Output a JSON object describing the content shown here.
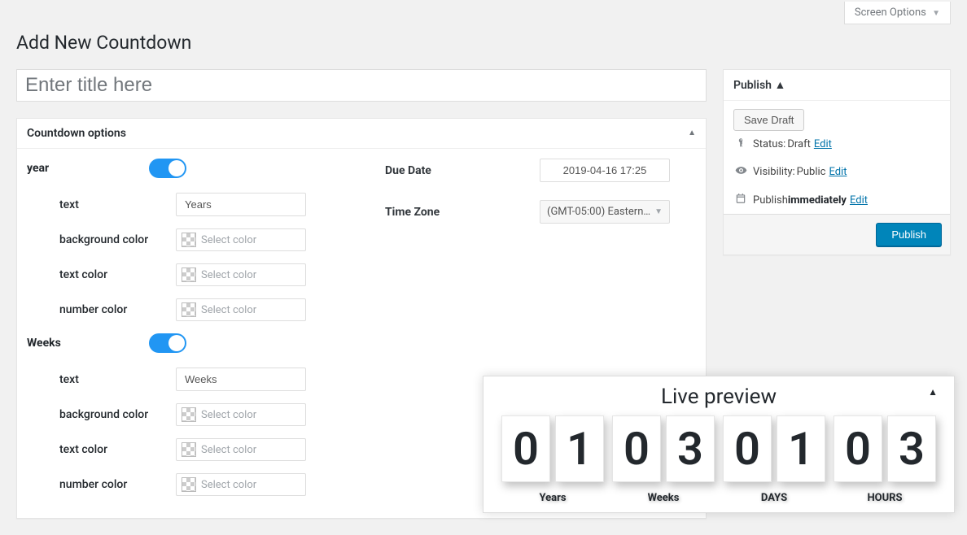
{
  "topbar": {
    "screen_options": "Screen Options"
  },
  "page": {
    "title": "Add New Countdown",
    "title_placeholder": "Enter title here"
  },
  "options": {
    "panel_title": "Countdown options",
    "color_placeholder": "Select color",
    "year": {
      "label": "year",
      "text_label": "text",
      "text_value": "Years",
      "bg_label": "background color",
      "tc_label": "text color",
      "nc_label": "number color"
    },
    "weeks": {
      "label": "Weeks",
      "text_label": "text",
      "text_value": "Weeks",
      "bg_label": "background color",
      "tc_label": "text color",
      "nc_label": "number color"
    },
    "right": {
      "due_label": "Due Date",
      "due_value": "2019-04-16 17:25",
      "tz_label": "Time Zone",
      "tz_value": "(GMT-05:00) Eastern ..."
    }
  },
  "publish": {
    "panel_title": "Publish",
    "save_draft": "Save Draft",
    "status_prefix": "Status: ",
    "status_value": "Draft",
    "visibility_prefix": "Visibility: ",
    "visibility_value": "Public",
    "schedule_prefix": "Publish ",
    "schedule_value": "immediately",
    "edit": "Edit",
    "publish_btn": "Publish"
  },
  "preview": {
    "title": "Live preview",
    "groups": [
      {
        "d1": "0",
        "d2": "1",
        "label": "Years"
      },
      {
        "d1": "0",
        "d2": "3",
        "label": "Weeks"
      },
      {
        "d1": "0",
        "d2": "1",
        "label": "DAYS"
      },
      {
        "d1": "0",
        "d2": "3",
        "label": "HOURS"
      }
    ]
  }
}
